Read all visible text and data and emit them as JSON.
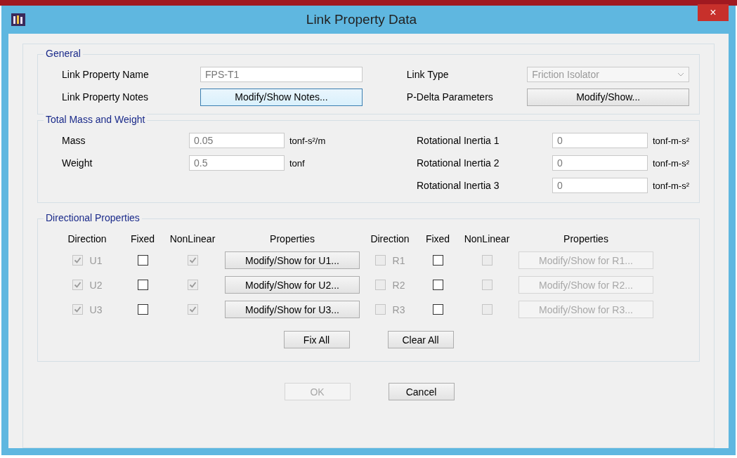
{
  "window": {
    "title": "Link Property Data",
    "close": "×"
  },
  "general": {
    "legend": "General",
    "name_label": "Link Property Name",
    "name_value": "FPS-T1",
    "notes_label": "Link Property Notes",
    "notes_button": "Modify/Show Notes...",
    "type_label": "Link Type",
    "type_value": "Friction Isolator",
    "type_disabled": true,
    "pdelta_label": "P-Delta Parameters",
    "pdelta_button": "Modify/Show..."
  },
  "mass": {
    "legend": "Total Mass and Weight",
    "left": [
      {
        "label": "Mass",
        "value": "0.05",
        "unit": "tonf-s²/m"
      },
      {
        "label": "Weight",
        "value": "0.5",
        "unit": "tonf"
      }
    ],
    "right": [
      {
        "label": "Rotational Inertia 1",
        "value": "0",
        "unit": "tonf-m-s²"
      },
      {
        "label": "Rotational Inertia 2",
        "value": "0",
        "unit": "tonf-m-s²"
      },
      {
        "label": "Rotational Inertia 3",
        "value": "0",
        "unit": "tonf-m-s²"
      }
    ]
  },
  "directional": {
    "legend": "Directional Properties",
    "headers": [
      "Direction",
      "Fixed",
      "NonLinear",
      "Properties",
      "Direction",
      "Fixed",
      "NonLinear",
      "Properties"
    ],
    "rows": [
      [
        {
          "direction": "U1",
          "checked": true,
          "fixed": false,
          "nonlinear": true,
          "disabled": false,
          "button": "Modify/Show for U1..."
        },
        {
          "direction": "R1",
          "checked": false,
          "fixed": false,
          "nonlinear": false,
          "disabled": true,
          "button": "Modify/Show for R1..."
        }
      ],
      [
        {
          "direction": "U2",
          "checked": true,
          "fixed": false,
          "nonlinear": true,
          "disabled": false,
          "button": "Modify/Show for U2..."
        },
        {
          "direction": "R2",
          "checked": false,
          "fixed": false,
          "nonlinear": false,
          "disabled": true,
          "button": "Modify/Show for R2..."
        }
      ],
      [
        {
          "direction": "U3",
          "checked": true,
          "fixed": false,
          "nonlinear": true,
          "disabled": false,
          "button": "Modify/Show for U3..."
        },
        {
          "direction": "R3",
          "checked": false,
          "fixed": false,
          "nonlinear": false,
          "disabled": true,
          "button": "Modify/Show for R3..."
        }
      ]
    ],
    "actions": [
      {
        "label": "Fix All",
        "disabled": false
      },
      {
        "label": "Clear All",
        "disabled": false
      }
    ]
  },
  "buttons": [
    {
      "label": "OK",
      "disabled": true
    },
    {
      "label": "Cancel",
      "disabled": false
    }
  ]
}
